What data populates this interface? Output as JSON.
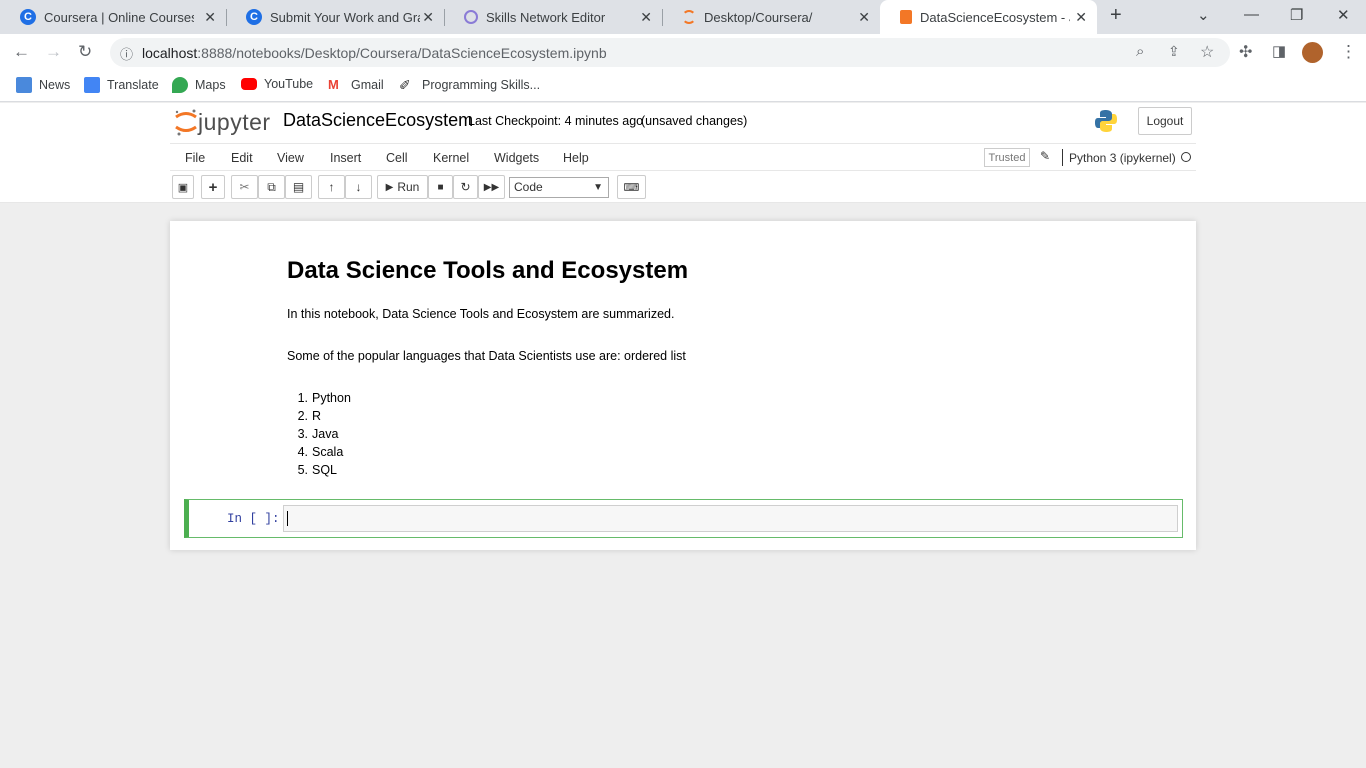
{
  "browser": {
    "tabs": [
      {
        "title": "Coursera | Online Courses &",
        "icon": "coursera-icon"
      },
      {
        "title": "Submit Your Work and Grade",
        "icon": "coursera-icon"
      },
      {
        "title": "Skills Network Editor",
        "icon": "skills-network-icon"
      },
      {
        "title": "Desktop/Coursera/",
        "icon": "jupyter-icon"
      },
      {
        "title": "DataScienceEcosystem - Jupy",
        "icon": "notebook-icon",
        "active": true
      }
    ],
    "url_host": "localhost",
    "url_path": ":8888/notebooks/Desktop/Coursera/DataScienceEcosystem.ipynb",
    "bookmarks": [
      {
        "label": "News",
        "icon": "news-icon"
      },
      {
        "label": "Translate",
        "icon": "translate-icon"
      },
      {
        "label": "Maps",
        "icon": "maps-icon"
      },
      {
        "label": "YouTube",
        "icon": "youtube-icon"
      },
      {
        "label": "Gmail",
        "icon": "gmail-icon"
      },
      {
        "label": "Programming Skills...",
        "icon": "programming-icon"
      }
    ]
  },
  "jupyter": {
    "logo_text": "jupyter",
    "notebook_name": "DataScienceEcosystem",
    "checkpoint": "Last Checkpoint: 4 minutes ago",
    "unsaved": "(unsaved changes)",
    "logout": "Logout",
    "menu": [
      "File",
      "Edit",
      "View",
      "Insert",
      "Cell",
      "Kernel",
      "Widgets",
      "Help"
    ],
    "trusted": "Trusted",
    "kernel": "Python 3 (ipykernel)",
    "run_label": "Run",
    "cell_type": "Code"
  },
  "notebook": {
    "heading": "Data Science Tools and Ecosystem",
    "intro": "In this notebook, Data Science Tools and Ecosystem are summarized.",
    "languages_intro": "Some of the popular languages that Data Scientists use are: ordered list",
    "languages": [
      "Python",
      "R",
      "Java",
      "Scala",
      "SQL"
    ],
    "prompt": "In [ ]:"
  },
  "colors": {
    "accent": "#4caf50",
    "jupyter_orange": "#f37726"
  }
}
